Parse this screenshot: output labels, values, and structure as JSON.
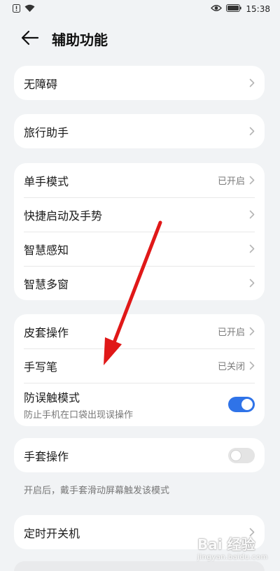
{
  "status_bar": {
    "time": "15:38"
  },
  "header": {
    "title": "辅助功能"
  },
  "cards": [
    {
      "items": [
        {
          "label": "无障碍"
        }
      ]
    },
    {
      "items": [
        {
          "label": "旅行助手"
        }
      ]
    },
    {
      "items": [
        {
          "label": "单手模式",
          "value": "已开启"
        },
        {
          "label": "快捷启动及手势"
        },
        {
          "label": "智慧感知"
        },
        {
          "label": "智慧多窗"
        }
      ]
    },
    {
      "items": [
        {
          "label": "皮套操作",
          "value": "已开启"
        },
        {
          "label": "手写笔",
          "value": "已关闭"
        },
        {
          "label": "防误触模式",
          "sublabel": "防止手机在口袋出现误操作",
          "toggle": true
        }
      ]
    },
    {
      "items": [
        {
          "label": "手套操作",
          "toggle": false
        }
      ]
    },
    {
      "items": [
        {
          "label": "定时开关机"
        }
      ]
    }
  ],
  "glove_note": "开启后，戴手套滑动屏幕触发该模式",
  "watermark": {
    "logo": "Bai 经验",
    "sub": "jingyan.baidu.com"
  },
  "colors": {
    "toggle_on": "#2f73e8",
    "annotation_arrow": "#e01818",
    "background": "#f1f3f5"
  }
}
